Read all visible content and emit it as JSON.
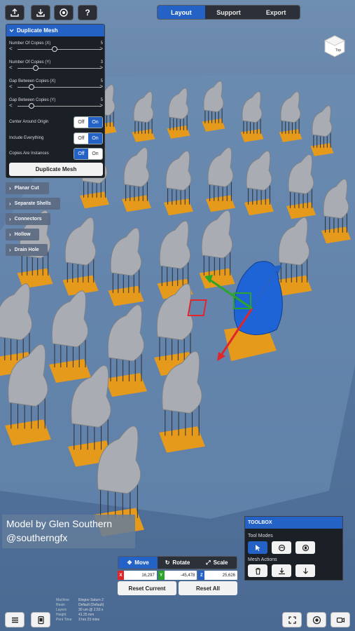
{
  "toolbar": {
    "icons": [
      "upload-icon",
      "download-icon",
      "settings-icon",
      "help-icon"
    ],
    "help_label": "?"
  },
  "tabs": [
    {
      "label": "Layout",
      "active": true
    },
    {
      "label": "Support",
      "active": false
    },
    {
      "label": "Export",
      "active": false
    }
  ],
  "viewcube": {
    "label": "Top"
  },
  "duplicate_panel": {
    "title": "Duplicate Mesh",
    "sliders": [
      {
        "label": "Number Of Copies (X)",
        "value": "5",
        "level": 0.45
      },
      {
        "label": "Number Of Copies (Y)",
        "value": "3",
        "level": 0.2
      },
      {
        "label": "Gap Between Copies (X)",
        "value": "5",
        "level": 0.15
      },
      {
        "label": "Gap Between Copies (Y)",
        "value": "5",
        "level": 0.15
      }
    ],
    "toggles": [
      {
        "label": "Center Around Origin",
        "off": "Off",
        "on": "On",
        "state": "on"
      },
      {
        "label": "Include Everything",
        "off": "Off",
        "on": "On",
        "state": "on"
      },
      {
        "label": "Copies Are Instances",
        "off": "Off",
        "on": "On",
        "state": "off"
      }
    ],
    "action": "Duplicate Mesh"
  },
  "sections": [
    "Planar Cut",
    "Separate Shells",
    "Connectors",
    "Hollow",
    "Drain Hole"
  ],
  "credit": {
    "line1": "Model by Glen Southern",
    "line2": "@southerngfx"
  },
  "toolbox": {
    "title": "TOOLBOX",
    "tool_modes_label": "Tool Modes",
    "mesh_actions_label": "Mesh Actions"
  },
  "transform": {
    "modes": [
      {
        "label": "Move",
        "active": true
      },
      {
        "label": "Rotate",
        "active": false
      },
      {
        "label": "Scale",
        "active": false
      }
    ],
    "coords": [
      {
        "axis": "X",
        "value": "16,297",
        "color": "#e0262b"
      },
      {
        "axis": "Y",
        "value": "-45,478",
        "color": "#2aa52a"
      },
      {
        "axis": "Z",
        "value": "25,626",
        "color": "#2462c6"
      }
    ],
    "reset_current": "Reset Current",
    "reset_all": "Reset All"
  },
  "print_info": [
    {
      "key": "Machine",
      "value": "Elegoo Saturn 2"
    },
    {
      "key": "Resin",
      "value": "Default (Default)"
    },
    {
      "key": "Layers",
      "value": "30 um @ 2.50 s"
    },
    {
      "key": "Height",
      "value": "41.25 mm"
    },
    {
      "key": "Print Time",
      "value": "3 hrs 23 mins"
    }
  ],
  "colors": {
    "accent": "#2462c6",
    "panel": "#1b1f26",
    "support": "#e69a1c",
    "mesh": "#a9adb3",
    "selected_mesh": "#1f64d6"
  }
}
